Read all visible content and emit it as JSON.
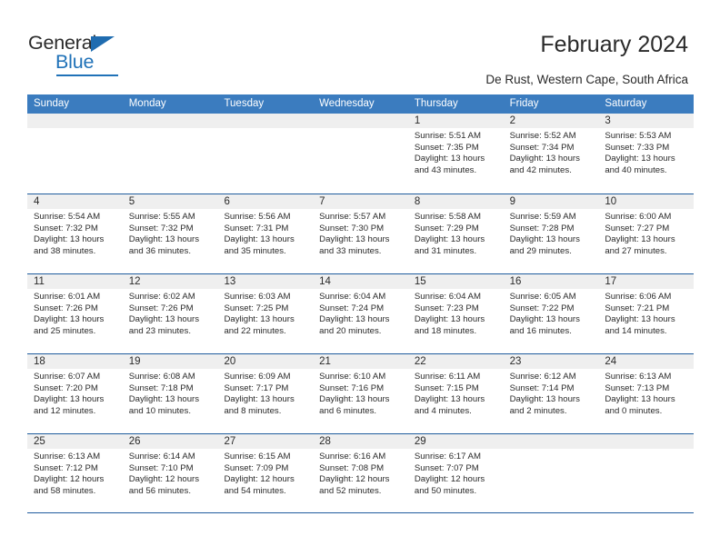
{
  "brand": {
    "name_part1": "General",
    "name_part2": "Blue",
    "accent_color": "#2072b8"
  },
  "header": {
    "title": "February 2024",
    "subtitle": "De Rust, Western Cape, South Africa"
  },
  "calendar": {
    "header_bg": "#3b7cbf",
    "week_divider_color": "#1f5c9e",
    "daynum_bg": "#efefef",
    "weekday_headers": [
      "Sunday",
      "Monday",
      "Tuesday",
      "Wednesday",
      "Thursday",
      "Friday",
      "Saturday"
    ],
    "weeks": [
      [
        {
          "day": "",
          "sunrise": "",
          "sunset": "",
          "daylight": "",
          "empty": true
        },
        {
          "day": "",
          "sunrise": "",
          "sunset": "",
          "daylight": "",
          "empty": true
        },
        {
          "day": "",
          "sunrise": "",
          "sunset": "",
          "daylight": "",
          "empty": true
        },
        {
          "day": "",
          "sunrise": "",
          "sunset": "",
          "daylight": "",
          "empty": true
        },
        {
          "day": "1",
          "sunrise": "Sunrise: 5:51 AM",
          "sunset": "Sunset: 7:35 PM",
          "daylight": "Daylight: 13 hours and 43 minutes."
        },
        {
          "day": "2",
          "sunrise": "Sunrise: 5:52 AM",
          "sunset": "Sunset: 7:34 PM",
          "daylight": "Daylight: 13 hours and 42 minutes."
        },
        {
          "day": "3",
          "sunrise": "Sunrise: 5:53 AM",
          "sunset": "Sunset: 7:33 PM",
          "daylight": "Daylight: 13 hours and 40 minutes."
        }
      ],
      [
        {
          "day": "4",
          "sunrise": "Sunrise: 5:54 AM",
          "sunset": "Sunset: 7:32 PM",
          "daylight": "Daylight: 13 hours and 38 minutes."
        },
        {
          "day": "5",
          "sunrise": "Sunrise: 5:55 AM",
          "sunset": "Sunset: 7:32 PM",
          "daylight": "Daylight: 13 hours and 36 minutes."
        },
        {
          "day": "6",
          "sunrise": "Sunrise: 5:56 AM",
          "sunset": "Sunset: 7:31 PM",
          "daylight": "Daylight: 13 hours and 35 minutes."
        },
        {
          "day": "7",
          "sunrise": "Sunrise: 5:57 AM",
          "sunset": "Sunset: 7:30 PM",
          "daylight": "Daylight: 13 hours and 33 minutes."
        },
        {
          "day": "8",
          "sunrise": "Sunrise: 5:58 AM",
          "sunset": "Sunset: 7:29 PM",
          "daylight": "Daylight: 13 hours and 31 minutes."
        },
        {
          "day": "9",
          "sunrise": "Sunrise: 5:59 AM",
          "sunset": "Sunset: 7:28 PM",
          "daylight": "Daylight: 13 hours and 29 minutes."
        },
        {
          "day": "10",
          "sunrise": "Sunrise: 6:00 AM",
          "sunset": "Sunset: 7:27 PM",
          "daylight": "Daylight: 13 hours and 27 minutes."
        }
      ],
      [
        {
          "day": "11",
          "sunrise": "Sunrise: 6:01 AM",
          "sunset": "Sunset: 7:26 PM",
          "daylight": "Daylight: 13 hours and 25 minutes."
        },
        {
          "day": "12",
          "sunrise": "Sunrise: 6:02 AM",
          "sunset": "Sunset: 7:26 PM",
          "daylight": "Daylight: 13 hours and 23 minutes."
        },
        {
          "day": "13",
          "sunrise": "Sunrise: 6:03 AM",
          "sunset": "Sunset: 7:25 PM",
          "daylight": "Daylight: 13 hours and 22 minutes."
        },
        {
          "day": "14",
          "sunrise": "Sunrise: 6:04 AM",
          "sunset": "Sunset: 7:24 PM",
          "daylight": "Daylight: 13 hours and 20 minutes."
        },
        {
          "day": "15",
          "sunrise": "Sunrise: 6:04 AM",
          "sunset": "Sunset: 7:23 PM",
          "daylight": "Daylight: 13 hours and 18 minutes."
        },
        {
          "day": "16",
          "sunrise": "Sunrise: 6:05 AM",
          "sunset": "Sunset: 7:22 PM",
          "daylight": "Daylight: 13 hours and 16 minutes."
        },
        {
          "day": "17",
          "sunrise": "Sunrise: 6:06 AM",
          "sunset": "Sunset: 7:21 PM",
          "daylight": "Daylight: 13 hours and 14 minutes."
        }
      ],
      [
        {
          "day": "18",
          "sunrise": "Sunrise: 6:07 AM",
          "sunset": "Sunset: 7:20 PM",
          "daylight": "Daylight: 13 hours and 12 minutes."
        },
        {
          "day": "19",
          "sunrise": "Sunrise: 6:08 AM",
          "sunset": "Sunset: 7:18 PM",
          "daylight": "Daylight: 13 hours and 10 minutes."
        },
        {
          "day": "20",
          "sunrise": "Sunrise: 6:09 AM",
          "sunset": "Sunset: 7:17 PM",
          "daylight": "Daylight: 13 hours and 8 minutes."
        },
        {
          "day": "21",
          "sunrise": "Sunrise: 6:10 AM",
          "sunset": "Sunset: 7:16 PM",
          "daylight": "Daylight: 13 hours and 6 minutes."
        },
        {
          "day": "22",
          "sunrise": "Sunrise: 6:11 AM",
          "sunset": "Sunset: 7:15 PM",
          "daylight": "Daylight: 13 hours and 4 minutes."
        },
        {
          "day": "23",
          "sunrise": "Sunrise: 6:12 AM",
          "sunset": "Sunset: 7:14 PM",
          "daylight": "Daylight: 13 hours and 2 minutes."
        },
        {
          "day": "24",
          "sunrise": "Sunrise: 6:13 AM",
          "sunset": "Sunset: 7:13 PM",
          "daylight": "Daylight: 13 hours and 0 minutes."
        }
      ],
      [
        {
          "day": "25",
          "sunrise": "Sunrise: 6:13 AM",
          "sunset": "Sunset: 7:12 PM",
          "daylight": "Daylight: 12 hours and 58 minutes."
        },
        {
          "day": "26",
          "sunrise": "Sunrise: 6:14 AM",
          "sunset": "Sunset: 7:10 PM",
          "daylight": "Daylight: 12 hours and 56 minutes."
        },
        {
          "day": "27",
          "sunrise": "Sunrise: 6:15 AM",
          "sunset": "Sunset: 7:09 PM",
          "daylight": "Daylight: 12 hours and 54 minutes."
        },
        {
          "day": "28",
          "sunrise": "Sunrise: 6:16 AM",
          "sunset": "Sunset: 7:08 PM",
          "daylight": "Daylight: 12 hours and 52 minutes."
        },
        {
          "day": "29",
          "sunrise": "Sunrise: 6:17 AM",
          "sunset": "Sunset: 7:07 PM",
          "daylight": "Daylight: 12 hours and 50 minutes."
        },
        {
          "day": "",
          "sunrise": "",
          "sunset": "",
          "daylight": "",
          "empty": true
        },
        {
          "day": "",
          "sunrise": "",
          "sunset": "",
          "daylight": "",
          "empty": true
        }
      ]
    ]
  }
}
